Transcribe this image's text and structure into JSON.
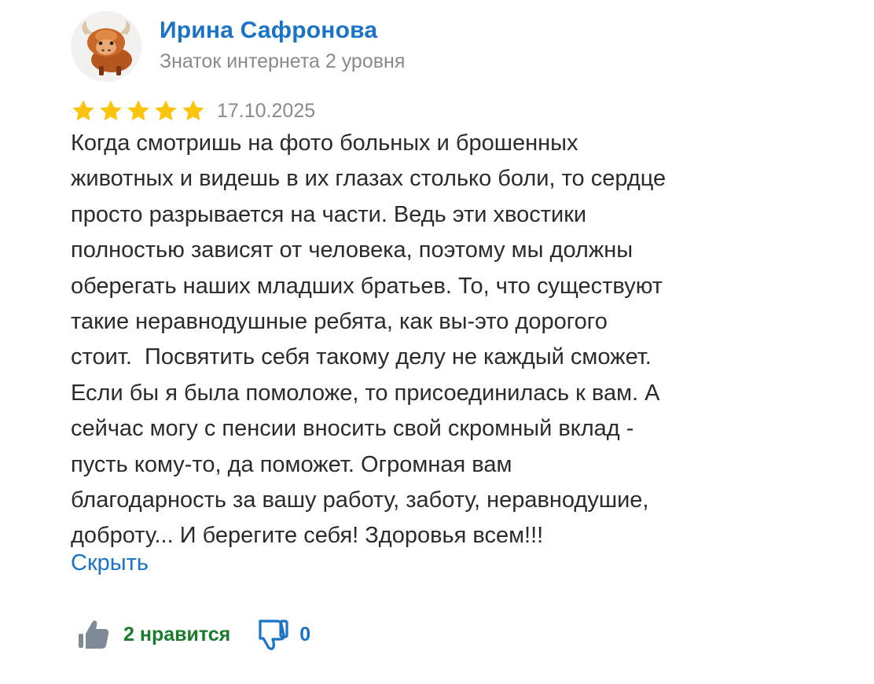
{
  "review": {
    "author": {
      "name": "Ирина Сафронова",
      "level": "Знаток интернета 2 уровня",
      "avatar_icon": "yak-avatar-icon"
    },
    "rating": {
      "stars": 5,
      "max": 5,
      "star_color": "#fcc40b"
    },
    "date": "17.10.2025",
    "text_lines": [
      "Когда смотришь на фото больных и брошенных",
      "животных и видешь в их глазах столько боли, то сердце",
      "просто разрывается на части. Ведь эти хвостики",
      "полностью зависят от человека, поэтому мы должны",
      "оберегать наших младших братьев. То, что существуют",
      "такие неравнодушные ребята, как вы-это дорогого",
      "стоит.  Посвятить себя такому делу не каждый сможет.",
      "Если бы я была помоложе, то присоединилась к вам. А",
      "сейчас могу с пенсии вносить свой скромный вклад -",
      "пусть кому-то, да поможет. Огромная вам",
      "благодарность за вашу работу, заботу, неравнодушие,",
      "доброту... И берегите себя! Здоровья всем!!!"
    ],
    "hide_label": "Скрыть",
    "reactions": {
      "likes_label": "2 нравится",
      "like_icon": "thumbs-up-icon",
      "dislikes_label": "0",
      "dislike_icon": "thumbs-down-icon"
    }
  },
  "colors": {
    "link": "#1a73c7",
    "secondary_text": "#8a8a8a",
    "like_text": "#1b7a2b",
    "like_icon": "#7f8a99"
  }
}
